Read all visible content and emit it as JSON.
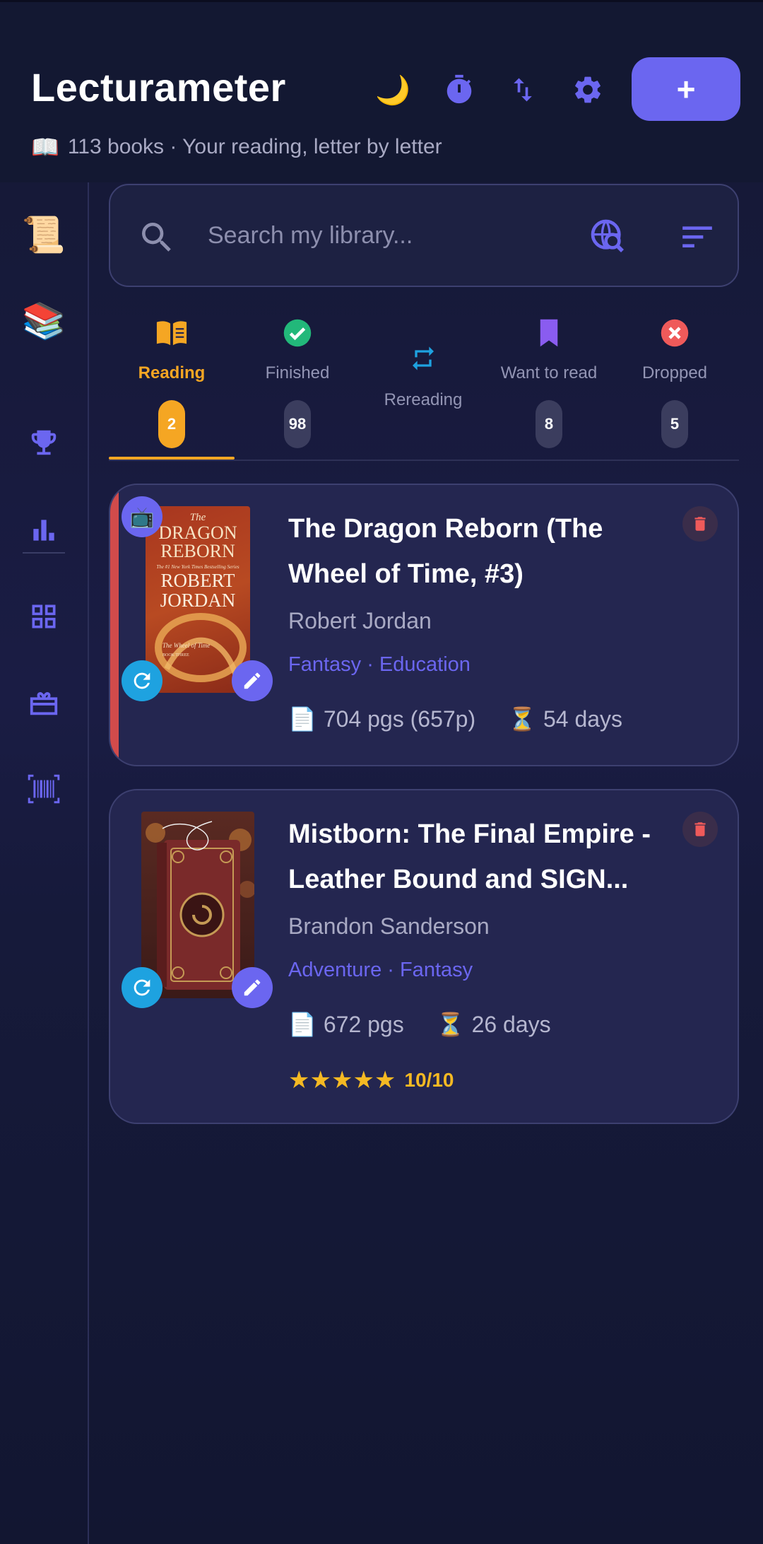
{
  "header": {
    "title": "Lecturameter",
    "subtitle_emoji": "📖",
    "subtitle": "113 books · Your reading, letter by letter",
    "moon_emoji": "🌙",
    "add_label": "+"
  },
  "sidebar": {
    "items": [
      {
        "icon": "scroll-icon",
        "emoji": "📜"
      },
      {
        "icon": "books-icon",
        "emoji": "📚"
      },
      {
        "icon": "trophy-icon"
      },
      {
        "icon": "bar-chart-icon"
      },
      {
        "icon": "grid-icon"
      },
      {
        "icon": "gift-icon"
      },
      {
        "icon": "barcode-icon"
      }
    ]
  },
  "search": {
    "placeholder": "Search my library..."
  },
  "tabs": [
    {
      "label": "Reading",
      "count": "2",
      "active": true,
      "color": "#f5a623"
    },
    {
      "label": "Finished",
      "count": "98",
      "color": "#22b87a"
    },
    {
      "label": "Rereading",
      "count": "",
      "color": "#1ea2e0"
    },
    {
      "label": "Want to read",
      "count": "8",
      "color": "#8a5cf0"
    },
    {
      "label": "Dropped",
      "count": "5",
      "color": "#ef5a5a"
    }
  ],
  "books": [
    {
      "title": "The Dragon Reborn (The Wheel of Time, #3)",
      "author": "Robert Jordan",
      "genres": "Fantasy · Education",
      "pages_emoji": "📄",
      "pages": "704 pgs (657p)",
      "time_emoji": "⏳",
      "days": "54 days",
      "cover": {
        "top": "The",
        "title1": "DRAGON",
        "title2": "REBORN",
        "tagline": "The #1 New York Times Bestselling Series",
        "author1": "ROBERT",
        "author2": "JORDAN",
        "series": "The Wheel of Time",
        "book": "BOOK THREE"
      },
      "tv_emoji": "📺"
    },
    {
      "title": "Mistborn: The Final Empire - Leather Bound and SIGN...",
      "author": "Brandon Sanderson",
      "genres": "Adventure · Fantasy",
      "pages_emoji": "📄",
      "pages": "672 pgs",
      "time_emoji": "⏳",
      "days": "26 days",
      "stars": "★★★★★",
      "rating": "10/10"
    }
  ],
  "colors": {
    "accent": "#6b66f0",
    "reading": "#f5a623",
    "delete": "#ef5a5a"
  }
}
